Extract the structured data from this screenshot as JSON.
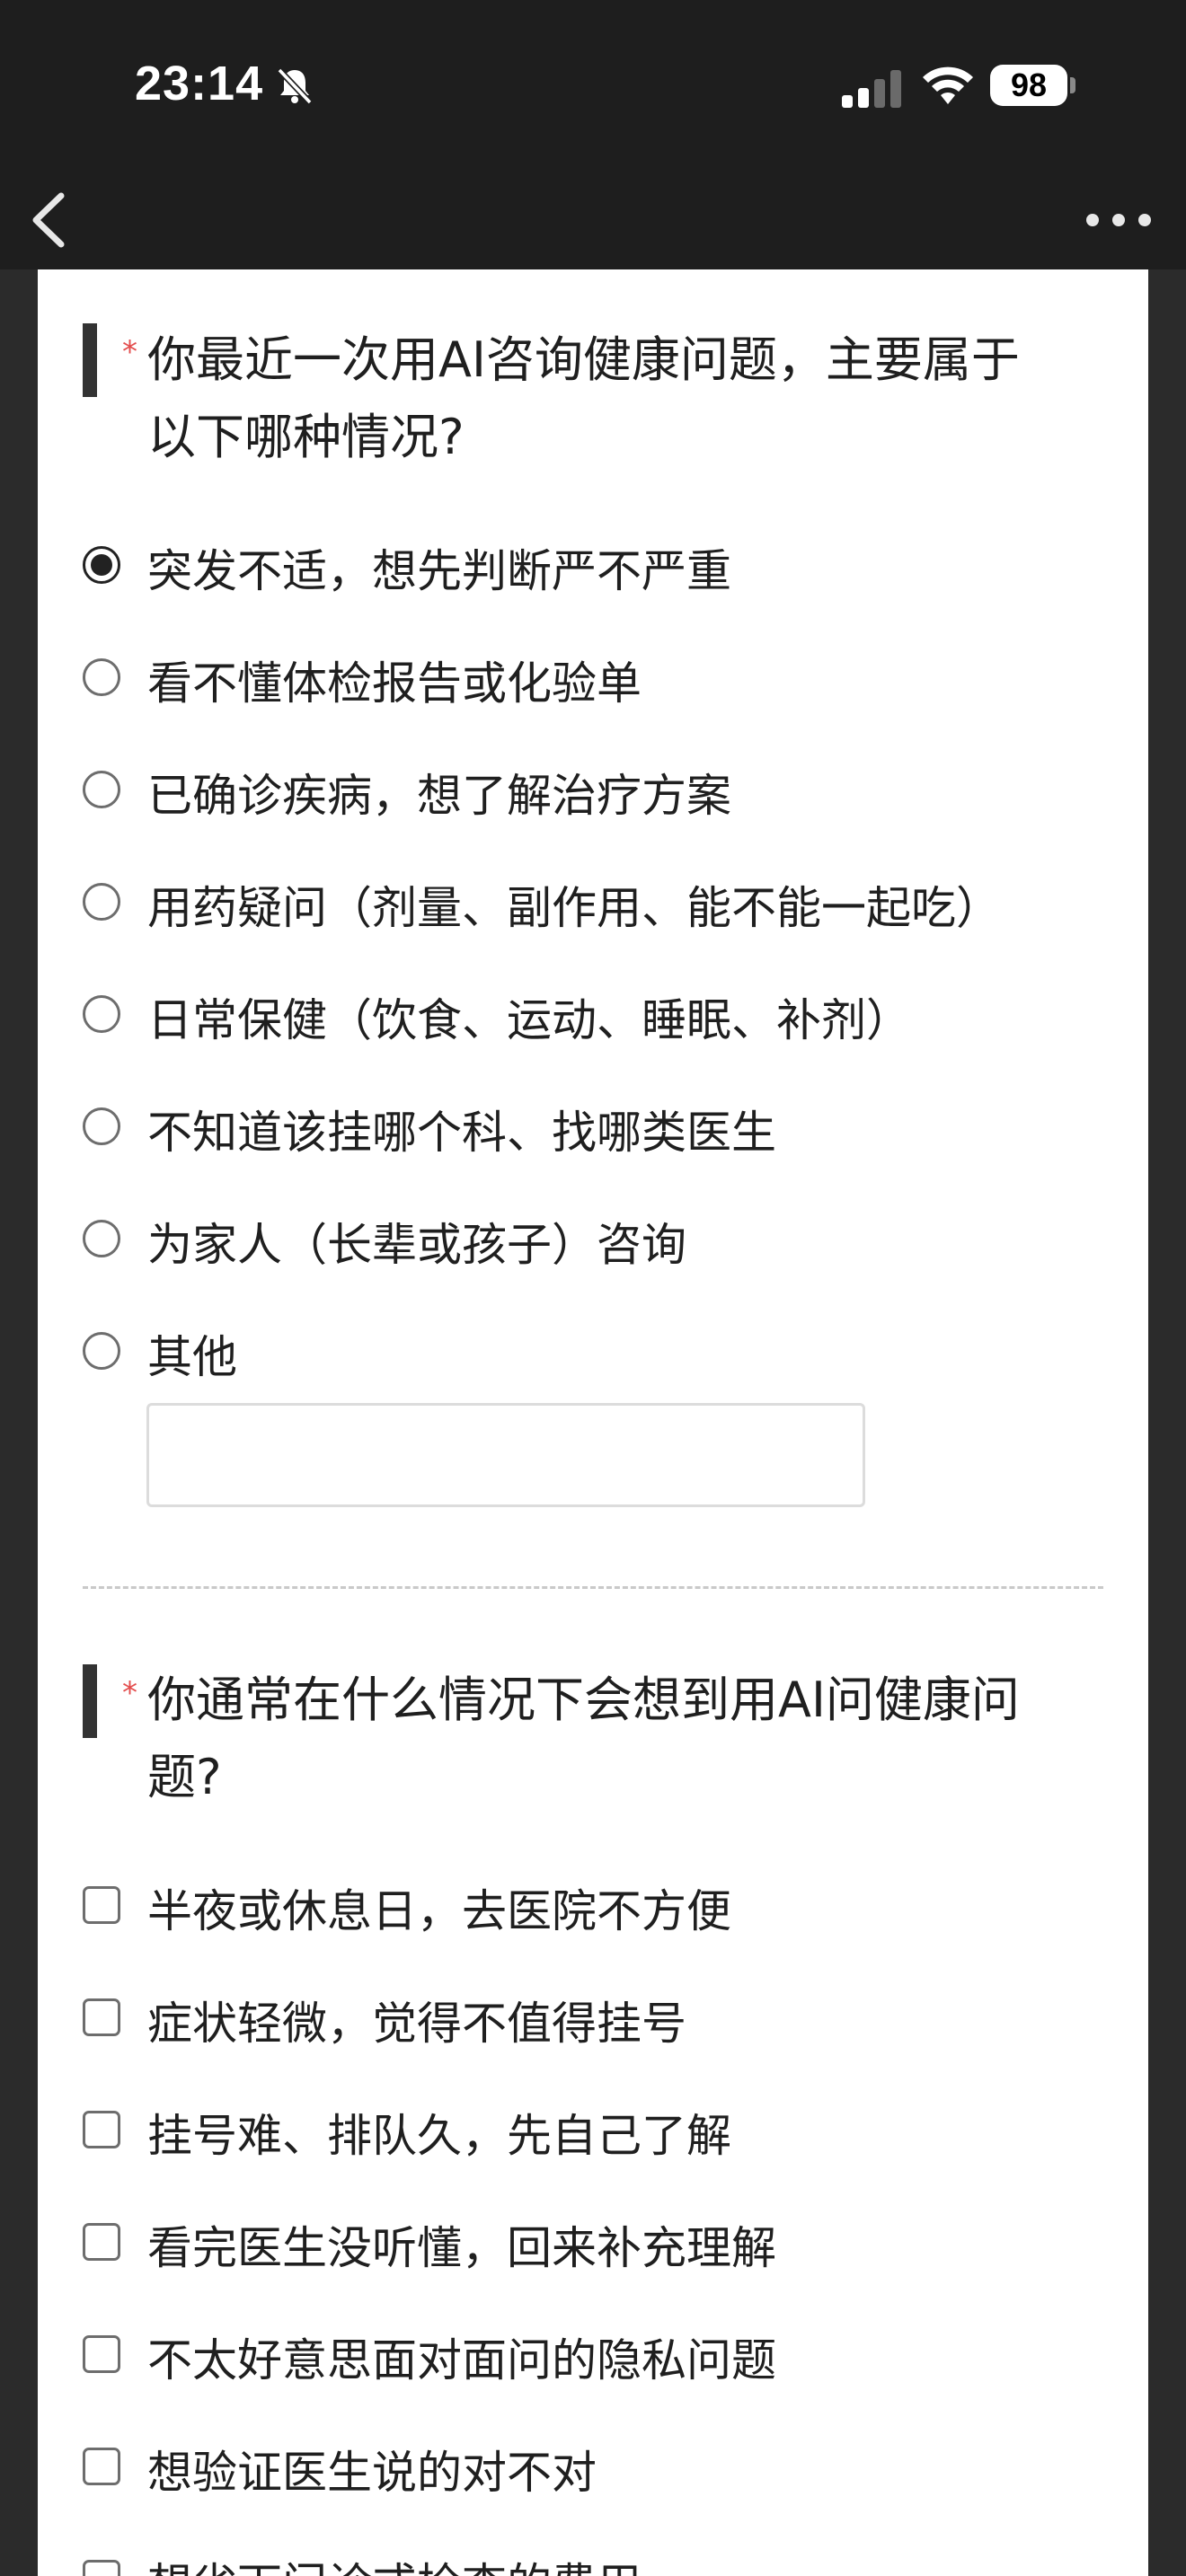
{
  "status_bar": {
    "time": "23:14",
    "battery": "98",
    "icons": [
      "bell-slash-icon",
      "signal-icon",
      "wifi-icon",
      "battery-icon"
    ]
  },
  "nav": {
    "title": "",
    "back_icon": "chevron-left-icon",
    "more_icon": "more-dots-icon"
  },
  "question1": {
    "required_mark": "*",
    "title_line1": "你最近一次用AI咨询健康问题，主要属于",
    "title_line2": "以下哪种情况?",
    "options": [
      {
        "label": "突发不适，想先判断严不严重",
        "checked": true
      },
      {
        "label": "看不懂体检报告或化验单",
        "checked": false
      },
      {
        "label": "已确诊疾病，想了解治疗方案",
        "checked": false
      },
      {
        "label": "用药疑问（剂量、副作用、能不能一起吃）",
        "checked": false
      },
      {
        "label": "日常保健（饮食、运动、睡眠、补剂）",
        "checked": false
      },
      {
        "label": "不知道该挂哪个科、找哪类医生",
        "checked": false
      },
      {
        "label": "为家人（长辈或孩子）咨询",
        "checked": false
      },
      {
        "label": "其他",
        "checked": false
      }
    ],
    "other_input_value": ""
  },
  "question2": {
    "required_mark": "*",
    "title_line1": "你通常在什么情况下会想到用AI问健康问",
    "title_line2": "题?",
    "options": [
      {
        "label": "半夜或休息日，去医院不方便"
      },
      {
        "label": "症状轻微，觉得不值得挂号"
      },
      {
        "label": "挂号难、排队久，先自己了解"
      },
      {
        "label": "看完医生没听懂，回来补充理解"
      },
      {
        "label": "不太好意思面对面问的隐私问题"
      },
      {
        "label": "想验证医生说的对不对"
      },
      {
        "label": "想省下门诊或检查的费用"
      }
    ]
  }
}
